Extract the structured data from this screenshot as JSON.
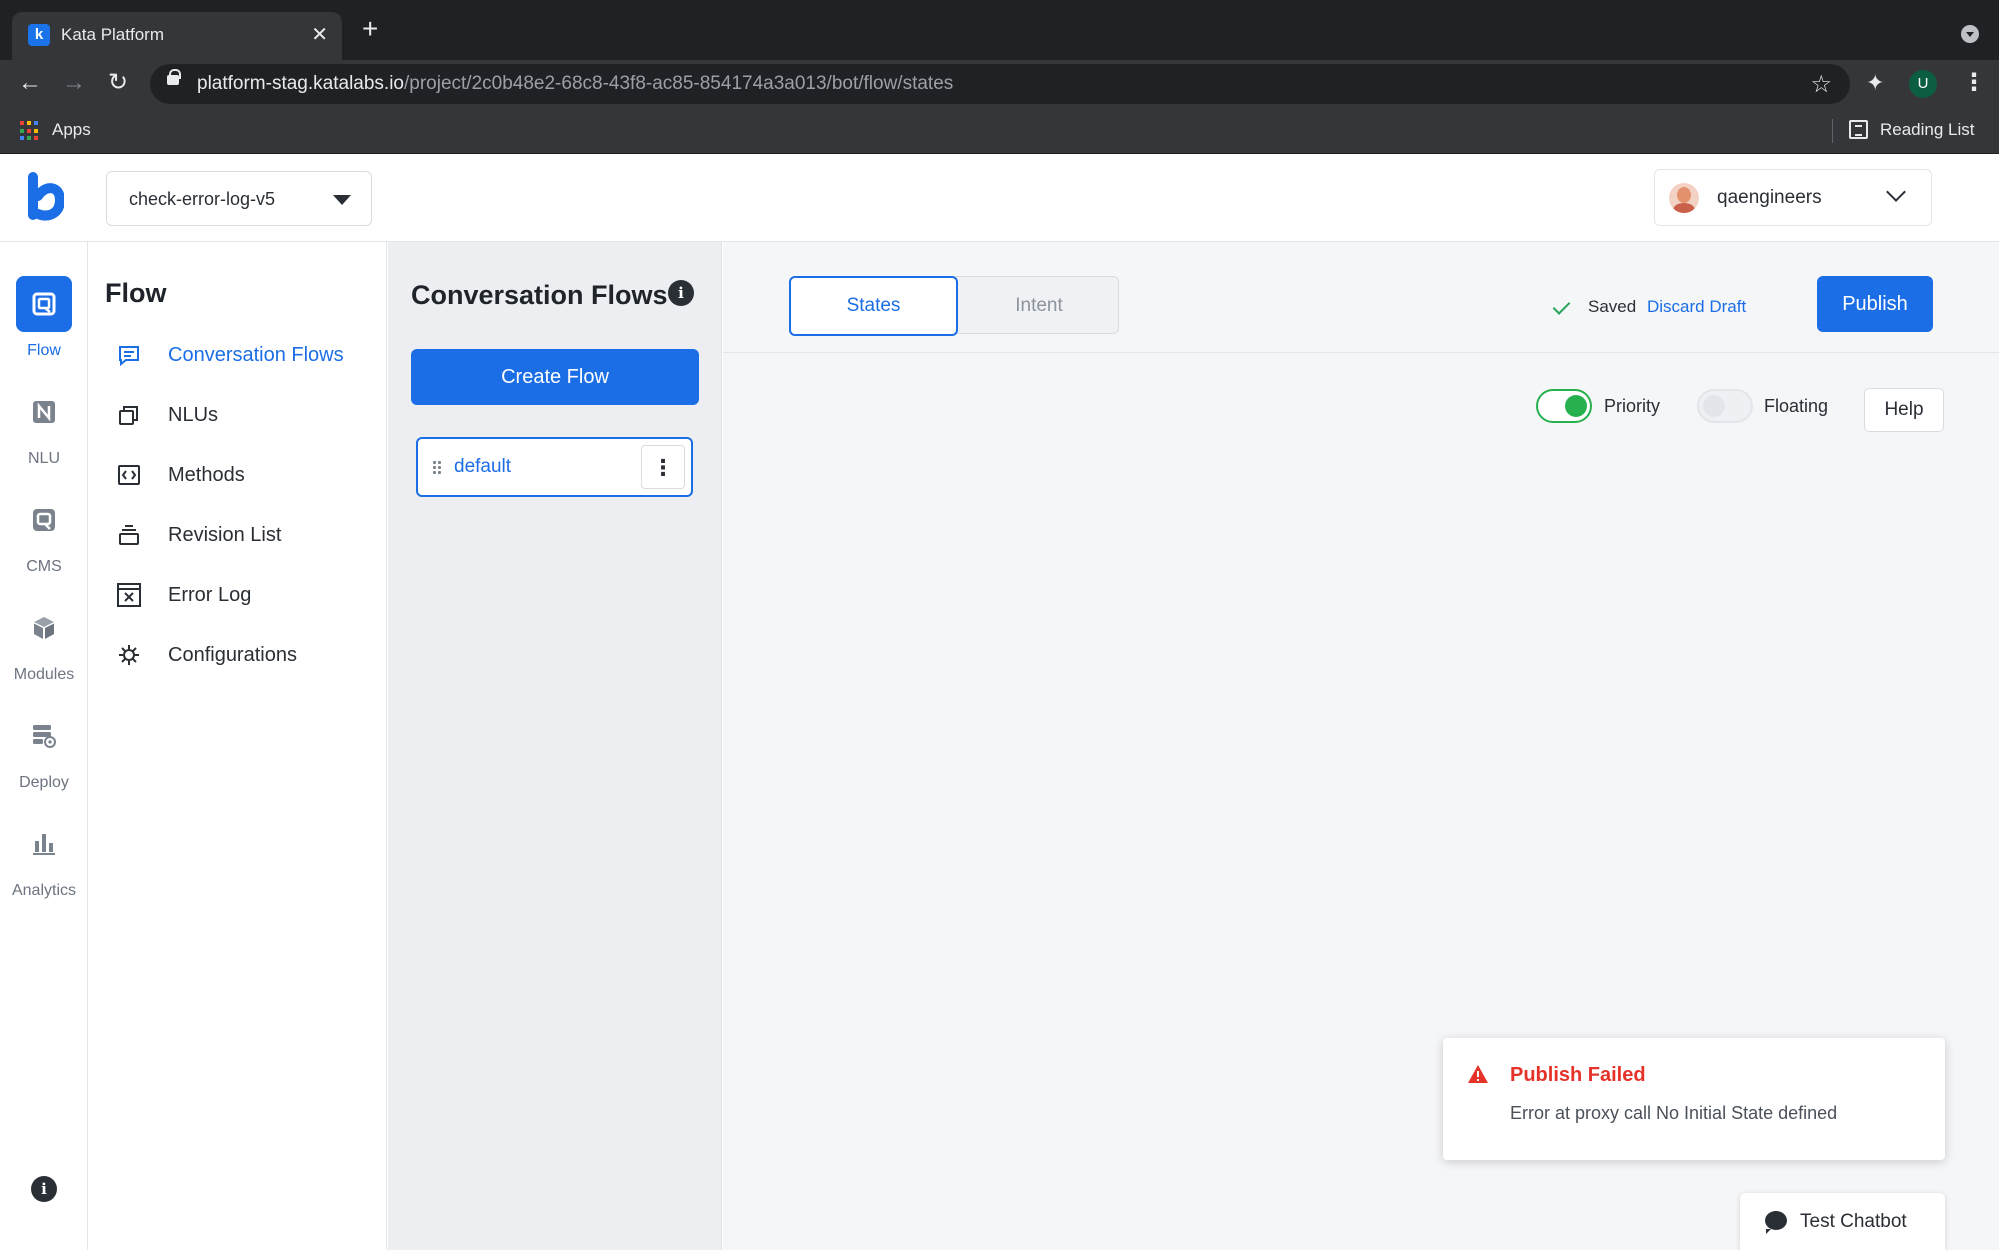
{
  "browser": {
    "tab_title": "Kata Platform",
    "url_host": "platform-stag.katalabs.io",
    "url_path": "/project/2c0b48e2-68c8-43f8-ac85-854174a3a013/bot/flow/states",
    "profile_initial": "U",
    "bookmarks": {
      "apps_label": "Apps",
      "reading_list_label": "Reading List"
    }
  },
  "header": {
    "project_name": "check-error-log-v5",
    "user_name": "qaengineers"
  },
  "rail": {
    "items": [
      {
        "label": "Flow",
        "icon": "flow-icon",
        "active": true
      },
      {
        "label": "NLU",
        "icon": "nlu-icon",
        "active": false
      },
      {
        "label": "CMS",
        "icon": "cms-icon",
        "active": false
      },
      {
        "label": "Modules",
        "icon": "modules-icon",
        "active": false
      },
      {
        "label": "Deploy",
        "icon": "deploy-icon",
        "active": false
      },
      {
        "label": "Analytics",
        "icon": "analytics-icon",
        "active": false
      }
    ]
  },
  "subnav": {
    "title": "Flow",
    "items": [
      {
        "label": "Conversation Flows",
        "icon": "chat-bubble-icon",
        "active": true
      },
      {
        "label": "NLUs",
        "icon": "nlu-stack-icon",
        "active": false
      },
      {
        "label": "Methods",
        "icon": "code-icon",
        "active": false
      },
      {
        "label": "Revision List",
        "icon": "revision-icon",
        "active": false
      },
      {
        "label": "Error Log",
        "icon": "error-log-icon",
        "active": false
      },
      {
        "label": "Configurations",
        "icon": "gear-icon",
        "active": false
      }
    ]
  },
  "flows": {
    "title": "Conversation Flows",
    "create_label": "Create Flow",
    "list": [
      {
        "name": "default"
      }
    ]
  },
  "main": {
    "tabs": {
      "states": "States",
      "intent": "Intent"
    },
    "saved_label": "Saved",
    "discard_label": "Discard Draft",
    "publish_label": "Publish",
    "toggles": {
      "priority": {
        "label": "Priority",
        "on": true
      },
      "floating": {
        "label": "Floating",
        "on": false
      }
    },
    "help_label": "Help"
  },
  "toast": {
    "title": "Publish Failed",
    "message": "Error at proxy call No Initial State defined"
  },
  "chatbot": {
    "label": "Test Chatbot"
  },
  "colors": {
    "accent": "#1b6ee6",
    "success": "#27b14e",
    "error": "#e5332a"
  }
}
